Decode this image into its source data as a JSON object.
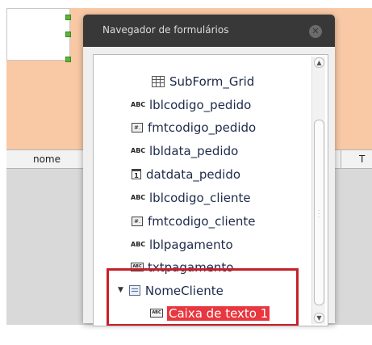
{
  "form": {
    "header_col_1": "nome",
    "header_col_2": "T"
  },
  "dialog": {
    "title": "Navegador de formulários",
    "close_symbol": "✕"
  },
  "tree": {
    "items": [
      {
        "label": "SubForm_Grid",
        "icon": "grid-icon"
      },
      {
        "label": "lblcodigo_pedido",
        "icon": "label-abc-icon",
        "icon_text": "ABC"
      },
      {
        "label": "fmtcodigo_pedido",
        "icon": "formatted-field-icon",
        "icon_text": "#."
      },
      {
        "label": "lbldata_pedido",
        "icon": "label-abc-icon",
        "icon_text": "ABC"
      },
      {
        "label": "datdata_pedido",
        "icon": "date-field-icon",
        "icon_text": "1"
      },
      {
        "label": "lblcodigo_cliente",
        "icon": "label-abc-icon",
        "icon_text": "ABC"
      },
      {
        "label": "fmtcodigo_cliente",
        "icon": "formatted-field-icon",
        "icon_text": "#."
      },
      {
        "label": "lblpagamento",
        "icon": "label-abc-icon",
        "icon_text": "ABC"
      },
      {
        "label": "txtpagamento",
        "icon": "text-box-icon",
        "icon_text": "ABC"
      },
      {
        "label": "NomeCliente",
        "icon": "list-box-icon",
        "expanded": true
      },
      {
        "label": "Caixa de texto 1",
        "icon": "text-box-icon",
        "icon_text": "ABC",
        "selected": true
      }
    ]
  },
  "colors": {
    "form_background": "#f9c8a4",
    "dialog_titlebar": "#383838",
    "selection": "#e8373f",
    "highlight_frame": "#c8202a"
  }
}
